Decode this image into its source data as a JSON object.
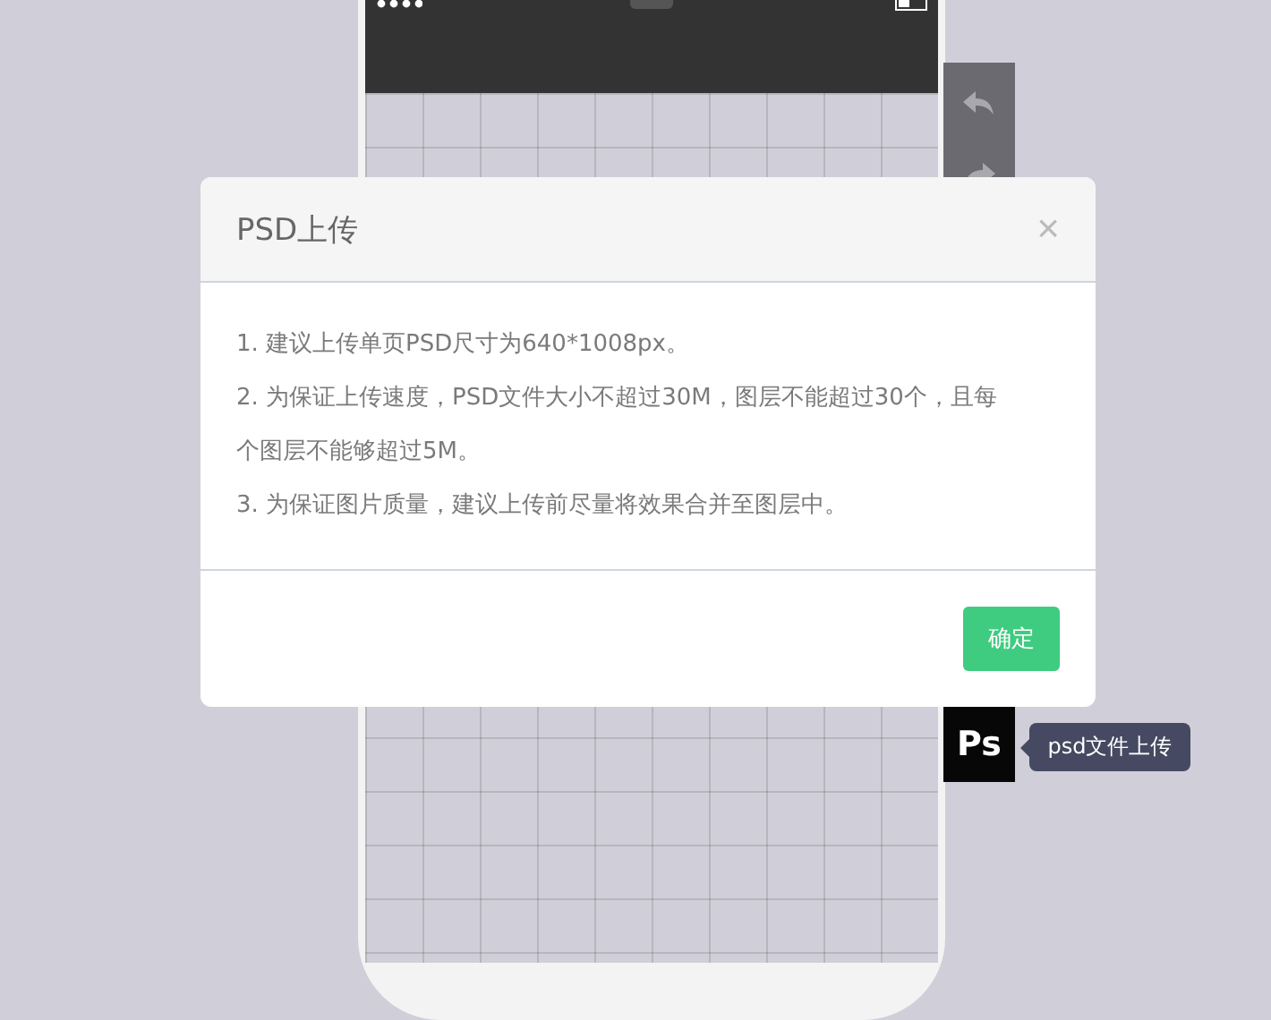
{
  "dialog": {
    "title": "PSD上传",
    "close": "×",
    "instructions": [
      "1. 建议上传单页PSD尺寸为640*1008px。",
      "2. 为保证上传速度，PSD文件大小不超过30M，图层不能超过30个，且每个图层不能够超过5M。",
      "3. 为保证图片质量，建议上传前尽量将效果合并至图层中。"
    ],
    "confirm_button": "确定"
  },
  "ps_button": {
    "label": "Ps",
    "tooltip": "psd文件上传"
  }
}
